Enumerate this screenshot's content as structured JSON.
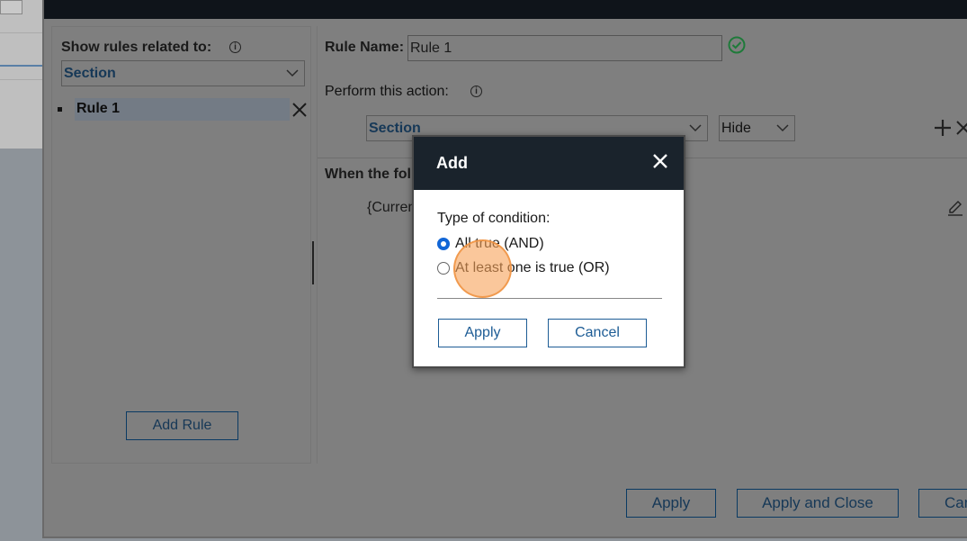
{
  "left_panel": {
    "label": "Show rules related to:",
    "filter_value": "Section",
    "rules": [
      {
        "label": "Rule 1"
      }
    ],
    "add_rule": "Add Rule"
  },
  "right_panel": {
    "rule_name_label": "Rule Name:",
    "rule_name_value": "Rule 1",
    "action_label": "Perform this action:",
    "action_target": "Section",
    "action_type": "Hide",
    "when_label": "When the foll",
    "condition": "{Curren"
  },
  "footer": {
    "apply": "Apply",
    "apply_close": "Apply and Close",
    "cancel": "Can"
  },
  "modal": {
    "title": "Add",
    "type_label": "Type of condition:",
    "options": [
      {
        "label": "All true (AND)",
        "checked": true
      },
      {
        "label": "At least one is true (OR)",
        "checked": false
      }
    ],
    "apply": "Apply",
    "cancel": "Cancel"
  },
  "colors": {
    "accent": "#1266d6",
    "header_dark": "#1a232c",
    "check_green": "#1f7a3a",
    "click_highlight": "#f7a258"
  }
}
